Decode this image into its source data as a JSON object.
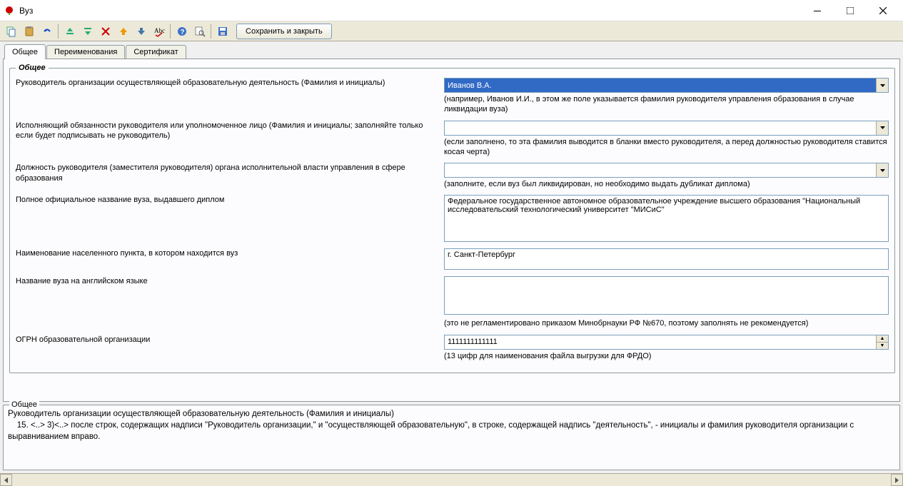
{
  "window": {
    "title": "Вуз"
  },
  "toolbar": {
    "save_close": "Сохранить и закрыть"
  },
  "tabs": [
    {
      "label": "Общее",
      "active": true
    },
    {
      "label": "Переименования",
      "active": false
    },
    {
      "label": "Сертификат",
      "active": false
    }
  ],
  "fieldset": {
    "legend": "Общее"
  },
  "fields": {
    "director": {
      "label": "Руководитель организации осуществляющей образовательную деятельность (Фамилия и инициалы)",
      "value": "Иванов В.А.",
      "hint": "(например, Иванов И.И., в этом же поле указывается фамилия руководителя управления образования в случае ликвидации вуза)"
    },
    "acting": {
      "label": "Исполняющий обязанности руководителя или уполномоченное лицо (Фамилия и инициалы; заполняйте только если будет подписывать не руководитель)",
      "value": "",
      "hint": "(если заполнено, то эта фамилия выводится в бланки вместо руководителя, а перед должностью руководителя ставится косая черта)"
    },
    "position": {
      "label": "Должность руководителя (заместителя руководителя) органа исполнительной власти управления в сфере образования",
      "value": "",
      "hint": "(заполните, если вуз был ликвидирован, но необходимо выдать дубликат диплома)"
    },
    "fullname": {
      "label": "Полное официальное название вуза, выдавшего диплом",
      "value": "Федеральное государственное автономное образовательное учреждение высшего образования \"Национальный исследовательский технологический университет \"МИСиС\""
    },
    "city": {
      "label": "Наименование населенного пункта, в котором находится вуз",
      "value": "г. Санкт-Петербург"
    },
    "name_en": {
      "label": "Название вуза на английском языке",
      "value": "",
      "hint": "(это не регламентировано приказом Минобрнауки РФ №670, поэтому заполнять не рекомендуется)"
    },
    "ogrn": {
      "label": "ОГРН образовательной организации",
      "value": "1111111111111",
      "hint": "(13 цифр для наименования файла выгрузки для ФРДО)"
    }
  },
  "help": {
    "title": "Общее",
    "heading": "Руководитель организации осуществляющей образовательную деятельность (Фамилия и инициалы)",
    "body": "    15. <..> 3)<..> после строк, содержащих надписи \"Руководитель организации,\" и \"осуществляющей образовательную\", в строке, содержащей надпись \"деятельность\", - инициалы и фамилия руководителя организации с выравниванием вправо."
  }
}
